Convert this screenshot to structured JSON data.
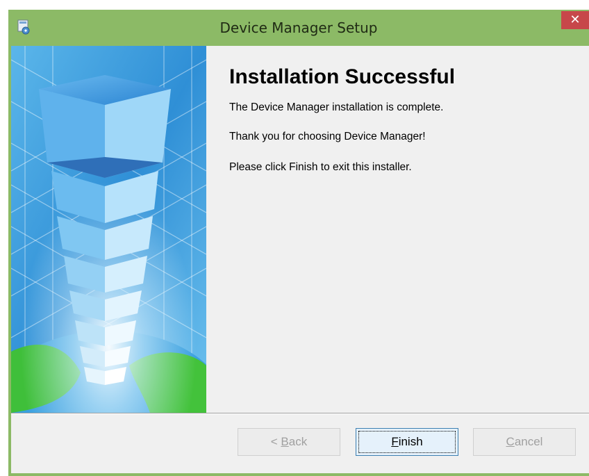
{
  "window": {
    "title": "Device Manager Setup",
    "close_glyph": "✕"
  },
  "content": {
    "heading": "Installation Successful",
    "lines": [
      "The Device Manager  installation is complete.",
      "Thank you for choosing Device Manager!",
      "Please click Finish to exit this installer."
    ]
  },
  "buttons": {
    "back": {
      "accel": "B",
      "rest": "ack",
      "prefix": "< ",
      "enabled": false
    },
    "finish": {
      "accel": "F",
      "rest": "inish",
      "enabled": true
    },
    "cancel": {
      "accel": "C",
      "rest": "ancel",
      "enabled": false
    }
  },
  "icons": {
    "app": "installer-icon",
    "close": "close-icon",
    "banner": "tower-globe-banner"
  },
  "colors": {
    "titlebar": "#8cba66",
    "close": "#c7474a",
    "client": "#f0f0f0"
  }
}
